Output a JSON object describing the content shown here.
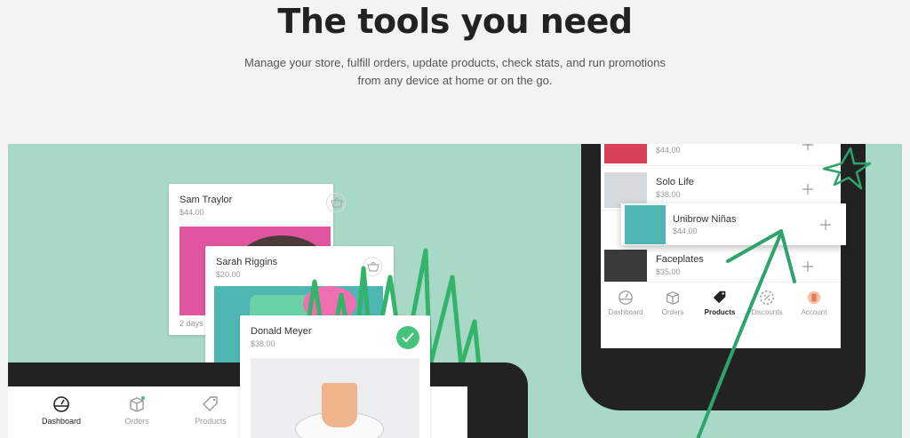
{
  "hero": {
    "title": "The tools you need",
    "subtitle_line1": "Manage your store, fulfill orders, update products, check stats, and run promotions",
    "subtitle_line2": "from any device at home or on the go."
  },
  "orders": [
    {
      "name": "Sam Traylor",
      "price": "$44.00",
      "footer": "2 days a"
    },
    {
      "name": "Sarah Riggins",
      "price": "$20.00"
    },
    {
      "name": "Donald Meyer",
      "price": "$38.00"
    }
  ],
  "laptop_nav": [
    "Dashboard",
    "Orders",
    "Products"
  ],
  "products": [
    {
      "name": "",
      "price": "$44.00"
    },
    {
      "name": "Solo Life",
      "price": "$38.00"
    },
    {
      "name": "Unibrow Niñas",
      "price": "$44.00"
    },
    {
      "name": "Faceplates",
      "price": "$35.00"
    }
  ],
  "phone_nav": [
    "Dashboard",
    "Orders",
    "Products",
    "Discounts",
    "Account"
  ],
  "colors": {
    "stage": "#a8d8c6",
    "accent_green": "#46c37b",
    "arrow": "#2ea36b"
  }
}
